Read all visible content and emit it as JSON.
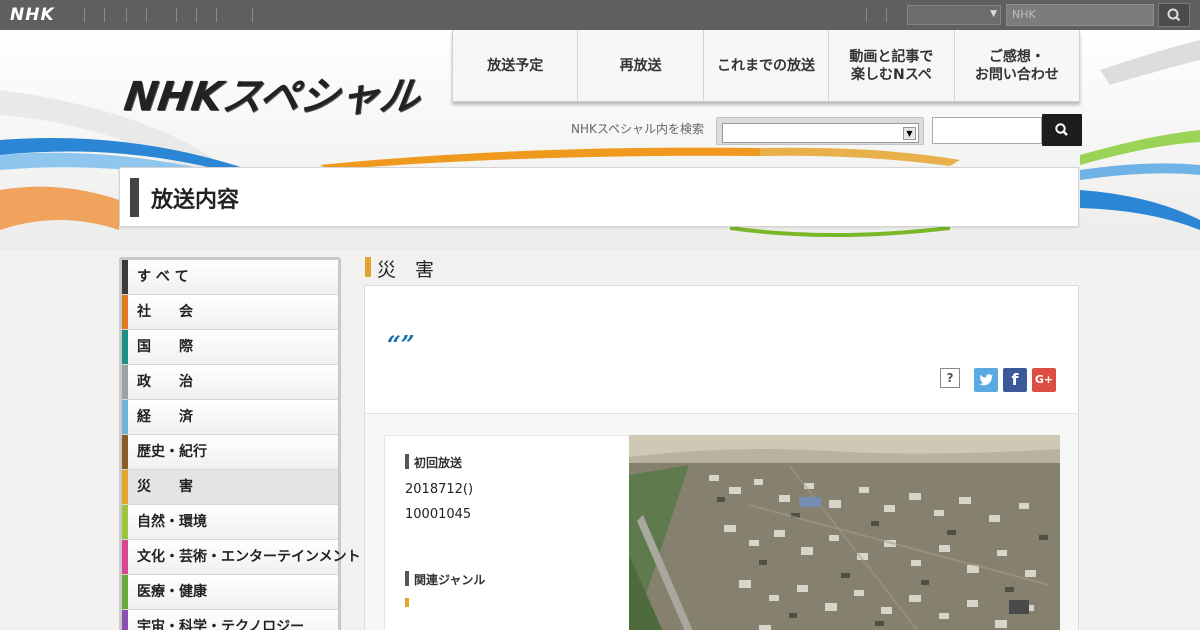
{
  "topbar": {
    "logo": "NHK",
    "search_placeholder": "NHK"
  },
  "brand": {
    "logo_text": "NHKスペシャル"
  },
  "mainnav": [
    {
      "label": "放送予定"
    },
    {
      "label": "再放送"
    },
    {
      "label": "これまでの放送"
    },
    {
      "label": "動画と記事で\n楽しむNスペ"
    },
    {
      "label": "ご感想・\nお問い合わせ"
    }
  ],
  "sitesearch": {
    "label": "NHKスペシャル内を検索"
  },
  "page": {
    "title": "放送内容"
  },
  "sidebar": {
    "items": [
      {
        "label": "す べ て",
        "color": "#3a3a3a"
      },
      {
        "label": "社　　会",
        "color": "#e07b25"
      },
      {
        "label": "国　　際",
        "color": "#1f8f86"
      },
      {
        "label": "政　　治",
        "color": "#9aa0a6"
      },
      {
        "label": "経　　済",
        "color": "#6cb4dc"
      },
      {
        "label": "歴史・紀行",
        "color": "#8b5a2b"
      },
      {
        "label": "災　　害",
        "color": "#e3a42b"
      },
      {
        "label": "自然・環境",
        "color": "#9cc63b"
      },
      {
        "label": "文化・芸術・エンターテインメント",
        "color": "#d8478f"
      },
      {
        "label": "医療・健康",
        "color": "#69a83a"
      },
      {
        "label": "宇宙・科学・テクノロジー",
        "color": "#8a4fb0"
      }
    ],
    "active_index": 6
  },
  "category": {
    "title": "災　害"
  },
  "program": {
    "title_quote": "“”",
    "help_label": "?",
    "share": {
      "twitter": "t",
      "facebook": "f",
      "google": "G+"
    },
    "first_broadcast_label": "初回放送",
    "first_broadcast_date": "2018712()",
    "first_broadcast_time": "10001045",
    "genre_label": "関連ジャンル"
  }
}
